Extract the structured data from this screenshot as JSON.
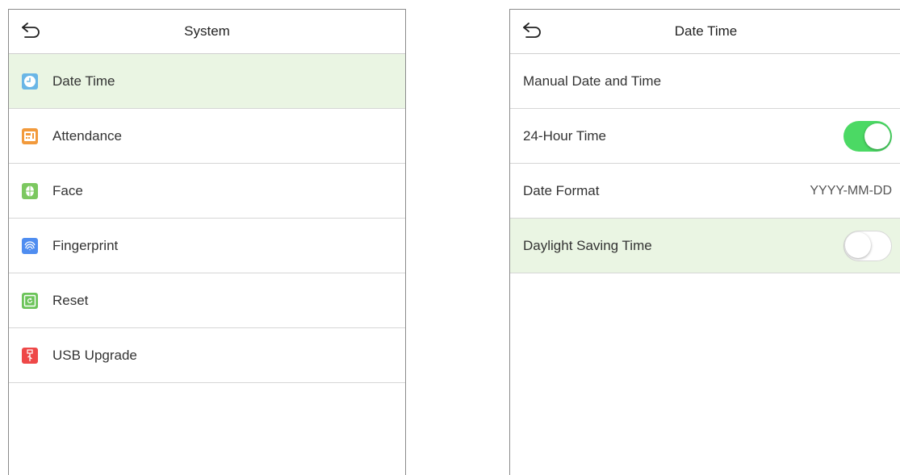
{
  "left_screen": {
    "title": "System",
    "items": [
      {
        "label": "Date Time",
        "icon": "clock-icon",
        "color": "#6ab6e6",
        "selected": true
      },
      {
        "label": "Attendance",
        "icon": "attendance-icon",
        "color": "#f29a3c",
        "selected": false
      },
      {
        "label": "Face",
        "icon": "face-icon",
        "color": "#7cc860",
        "selected": false
      },
      {
        "label": "Fingerprint",
        "icon": "fingerprint-icon",
        "color": "#4f8df0",
        "selected": false
      },
      {
        "label": "Reset",
        "icon": "reset-icon",
        "color": "#6cc45a",
        "selected": false
      },
      {
        "label": "USB Upgrade",
        "icon": "usb-icon",
        "color": "#ee4848",
        "selected": false
      }
    ]
  },
  "right_screen": {
    "title": "Date Time",
    "items": [
      {
        "label": "Manual Date and Time"
      },
      {
        "label": "24-Hour Time",
        "toggle": "on"
      },
      {
        "label": "Date Format",
        "value": "YYYY-MM-DD"
      },
      {
        "label": "Daylight Saving Time",
        "toggle": "off",
        "selected": true
      }
    ]
  },
  "colors": {
    "selected_row": "#eaf5e3",
    "toggle_on": "#4bd964"
  }
}
